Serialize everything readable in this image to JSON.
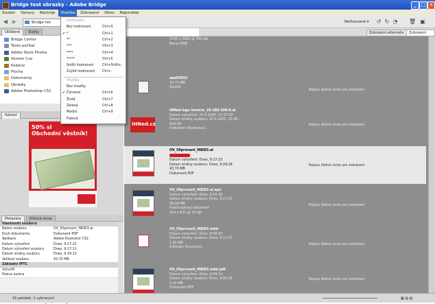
{
  "window": {
    "title": "Bridge test obrazky - Adobe Bridge"
  },
  "menubar": [
    "Soubor",
    "Úpravy",
    "Nástroje",
    "Visačka",
    "Zobrazení",
    "Okno",
    "Nápověda"
  ],
  "toolbar": {
    "path": "Bridge tes",
    "sort": "Neřízované ▾"
  },
  "view_buttons": {
    "alt": "Zobrazení alternativ",
    "ver": "Zobrazení verzí"
  },
  "label_menu": {
    "items": [
      {
        "label": "Hodnocení",
        "shortcut": "",
        "disabled": true,
        "check": ""
      },
      {
        "label": "Bez hodnocení",
        "shortcut": "Ctrl+0",
        "disabled": false,
        "check": ""
      },
      {
        "label": "*",
        "shortcut": "Ctrl+1",
        "disabled": false,
        "check": "✔"
      },
      {
        "label": "**",
        "shortcut": "Ctrl+2",
        "disabled": false,
        "check": ""
      },
      {
        "label": "***",
        "shortcut": "Ctrl+3",
        "disabled": false,
        "check": ""
      },
      {
        "label": "****",
        "shortcut": "Ctrl+4",
        "disabled": false,
        "check": ""
      },
      {
        "label": "*****",
        "shortcut": "Ctrl+5",
        "disabled": false,
        "check": ""
      },
      {
        "label": "Snížit hodnocení",
        "shortcut": "Ctrl+Shift+,",
        "disabled": false,
        "check": ""
      },
      {
        "label": "Zvýšit hodnocení",
        "shortcut": "Ctrl+.",
        "disabled": false,
        "check": ""
      },
      {
        "label": "Visačka",
        "shortcut": "",
        "disabled": true,
        "check": ""
      },
      {
        "label": "Bez visačky",
        "shortcut": "",
        "disabled": false,
        "check": ""
      },
      {
        "label": "Červená",
        "shortcut": "Ctrl+6",
        "disabled": false,
        "check": "✔"
      },
      {
        "label": "Žlutá",
        "shortcut": "Ctrl+7",
        "disabled": false,
        "check": ""
      },
      {
        "label": "Zelená",
        "shortcut": "Ctrl+8",
        "disabled": false,
        "check": ""
      },
      {
        "label": "Modrá",
        "shortcut": "Ctrl+9",
        "disabled": false,
        "check": ""
      },
      {
        "label": "Fialová",
        "shortcut": "",
        "disabled": false,
        "check": ""
      }
    ]
  },
  "left_tabs": {
    "fav": "Oblíbené",
    "folders": "Složky",
    "preview": "Náhled",
    "meta": "Metadata",
    "keywords": "Klíčová slova"
  },
  "favorites": [
    {
      "label": "Bridge Center",
      "color": "#5b8fd6"
    },
    {
      "label": "Tento počítač",
      "color": "#7c8ea3"
    },
    {
      "label": "Adobe Stock Photos",
      "color": "#345e9c"
    },
    {
      "label": "Version Cue",
      "color": "#4d7f3a"
    },
    {
      "label": "Kolekce",
      "color": "#a8702c"
    },
    {
      "label": "Plocha",
      "color": "#6aa3e0"
    },
    {
      "label": "Dokumenty",
      "color": "#e3c25a"
    },
    {
      "label": "Obrázky",
      "color": "#e3c25a"
    },
    {
      "label": "Adobe Photoshop CS2",
      "color": "#2e5f9e"
    }
  ],
  "preview": {
    "headline_1": "50% sl",
    "headline_2": "Obchodní věstník!",
    "filename": "OV_50procent_INDD3.ai"
  },
  "metadata": {
    "section_file": "Vlastnosti souboru",
    "rows": [
      {
        "k": "Název souboru",
        "v": "OV_50procent_INDD3.ai"
      },
      {
        "k": "Druh dokumentu",
        "v": "Dokument PDF"
      },
      {
        "k": "Aplikace",
        "v": "Adobe Illustrator CS2"
      },
      {
        "k": "Datum vytvoření",
        "v": "Dnes, 9:17:23"
      },
      {
        "k": "Datum vytvoření souboru",
        "v": "Dnes, 9:17:11"
      },
      {
        "k": "Datum změny souboru",
        "v": "Dnes, 9:34:13"
      },
      {
        "k": "Velikost souboru",
        "v": "43,70 MB"
      }
    ],
    "section_iptc": "Základní IPTC",
    "iptc_rows": [
      {
        "k": "Vytvořil",
        "v": ""
      },
      {
        "k": "Pozice autora",
        "v": ""
      }
    ]
  },
  "items": [
    {
      "name": "",
      "lines": [
        "3300 x 5092 @ 300 dpi",
        "Barva RGB"
      ],
      "version": "",
      "selected": false
    },
    {
      "name": "aaa03852",
      "lines": [
        "43,71 MB",
        "Soubor",
        "-",
        "-",
        "-"
      ],
      "version": "Nejsou žádné verze pro zobrazení",
      "selected": false
    },
    {
      "name": "iHNed logo inverze_20-180-100-0.ai",
      "lines": [
        "Datum vytvoření: 20.4.2005, 13:37:53",
        "Datum změny souboru: 20.4.2005, 13:46:...",
        "429 KB",
        "Dokument Illustratoru"
      ],
      "version": "Nejsou žádné verze pro zobrazení",
      "selected": false
    },
    {
      "name": "OV_50procent_INDD3.ai",
      "lines": [
        "",
        "Datum vytvoření: Dnes, 9:17:23",
        "Datum změny souboru: Dnes, 9:34:28",
        "43,70 MB",
        "Dokument PDF"
      ],
      "version": "Nejsou žádné verze pro zobrazení",
      "selected": true
    },
    {
      "name": "OV_50procent_INDD3.ai.eps",
      "lines": [
        "Datum vytvoření: Dnes, 9:16:36",
        "Datum změny souboru: Dnes, 9:17:01",
        "58,04 MB",
        "PostScriptový dokument",
        "414 x 601 @ 72 dpi"
      ],
      "version": "Nejsou žádné verze pro zobrazení",
      "selected": false
    },
    {
      "name": "OV_50procent_INDD3.indd",
      "lines": [
        "Datum vytvoření: Dnes, 9:00:33",
        "Datum změny souboru: Dnes, 9:11:53",
        "1,82 MB",
        "InDesign Document"
      ],
      "version": "Nejsou žádné verze pro zobrazení",
      "selected": false
    },
    {
      "name": "OV_50procent_INDD3.indd.pdf",
      "lines": [
        "Datum vytvoření: Dnes, 9:09:14",
        "Datum změny souboru: Dnes, 9:09:28",
        "5,42 MB",
        "Dokument PDF"
      ],
      "version": "Nejsou žádné verze pro zobrazení",
      "selected": false
    }
  ],
  "thumb_logo_text": "iHNed.cz",
  "status": "16 položek, 1 vybraných",
  "colors": {
    "title": "#2657c9",
    "selection": "#316ac5",
    "label_red": "#d01d1d",
    "content_bg": "#8e8e8e"
  }
}
